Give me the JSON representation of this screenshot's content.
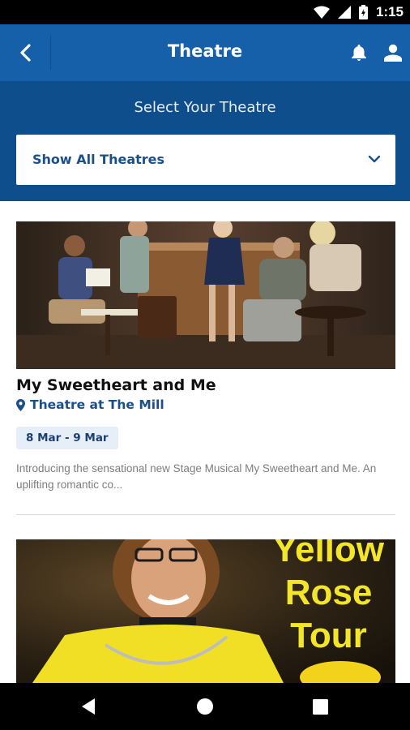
{
  "status_bar": {
    "time": "1:15"
  },
  "app_bar": {
    "title": "Theatre"
  },
  "selector": {
    "heading": "Select Your Theatre",
    "selected": "Show All Theatres"
  },
  "events": [
    {
      "title": "My Sweetheart and Me",
      "venue": "Theatre at The Mill",
      "dates": "8 Mar - 9 Mar",
      "description": "Introducing the sensational new Stage Musical My Sweetheart and Me. An uplifting romantic co..."
    },
    {
      "poster_text": [
        "Yellow",
        "Rose",
        "Tour"
      ]
    }
  ],
  "colors": {
    "app_bar": "#1560a8",
    "selector_panel": "#0f4e8c",
    "accent_text": "#1b4f8a",
    "date_badge_bg": "#e6eef8",
    "poster_yellow": "#f3e62a"
  },
  "icons": [
    "back-arrow-icon",
    "bell-icon",
    "user-icon",
    "chevron-down-icon",
    "location-pin-icon",
    "wifi-icon",
    "signal-icon",
    "battery-icon",
    "nav-back-icon",
    "nav-home-icon",
    "nav-recents-icon"
  ]
}
